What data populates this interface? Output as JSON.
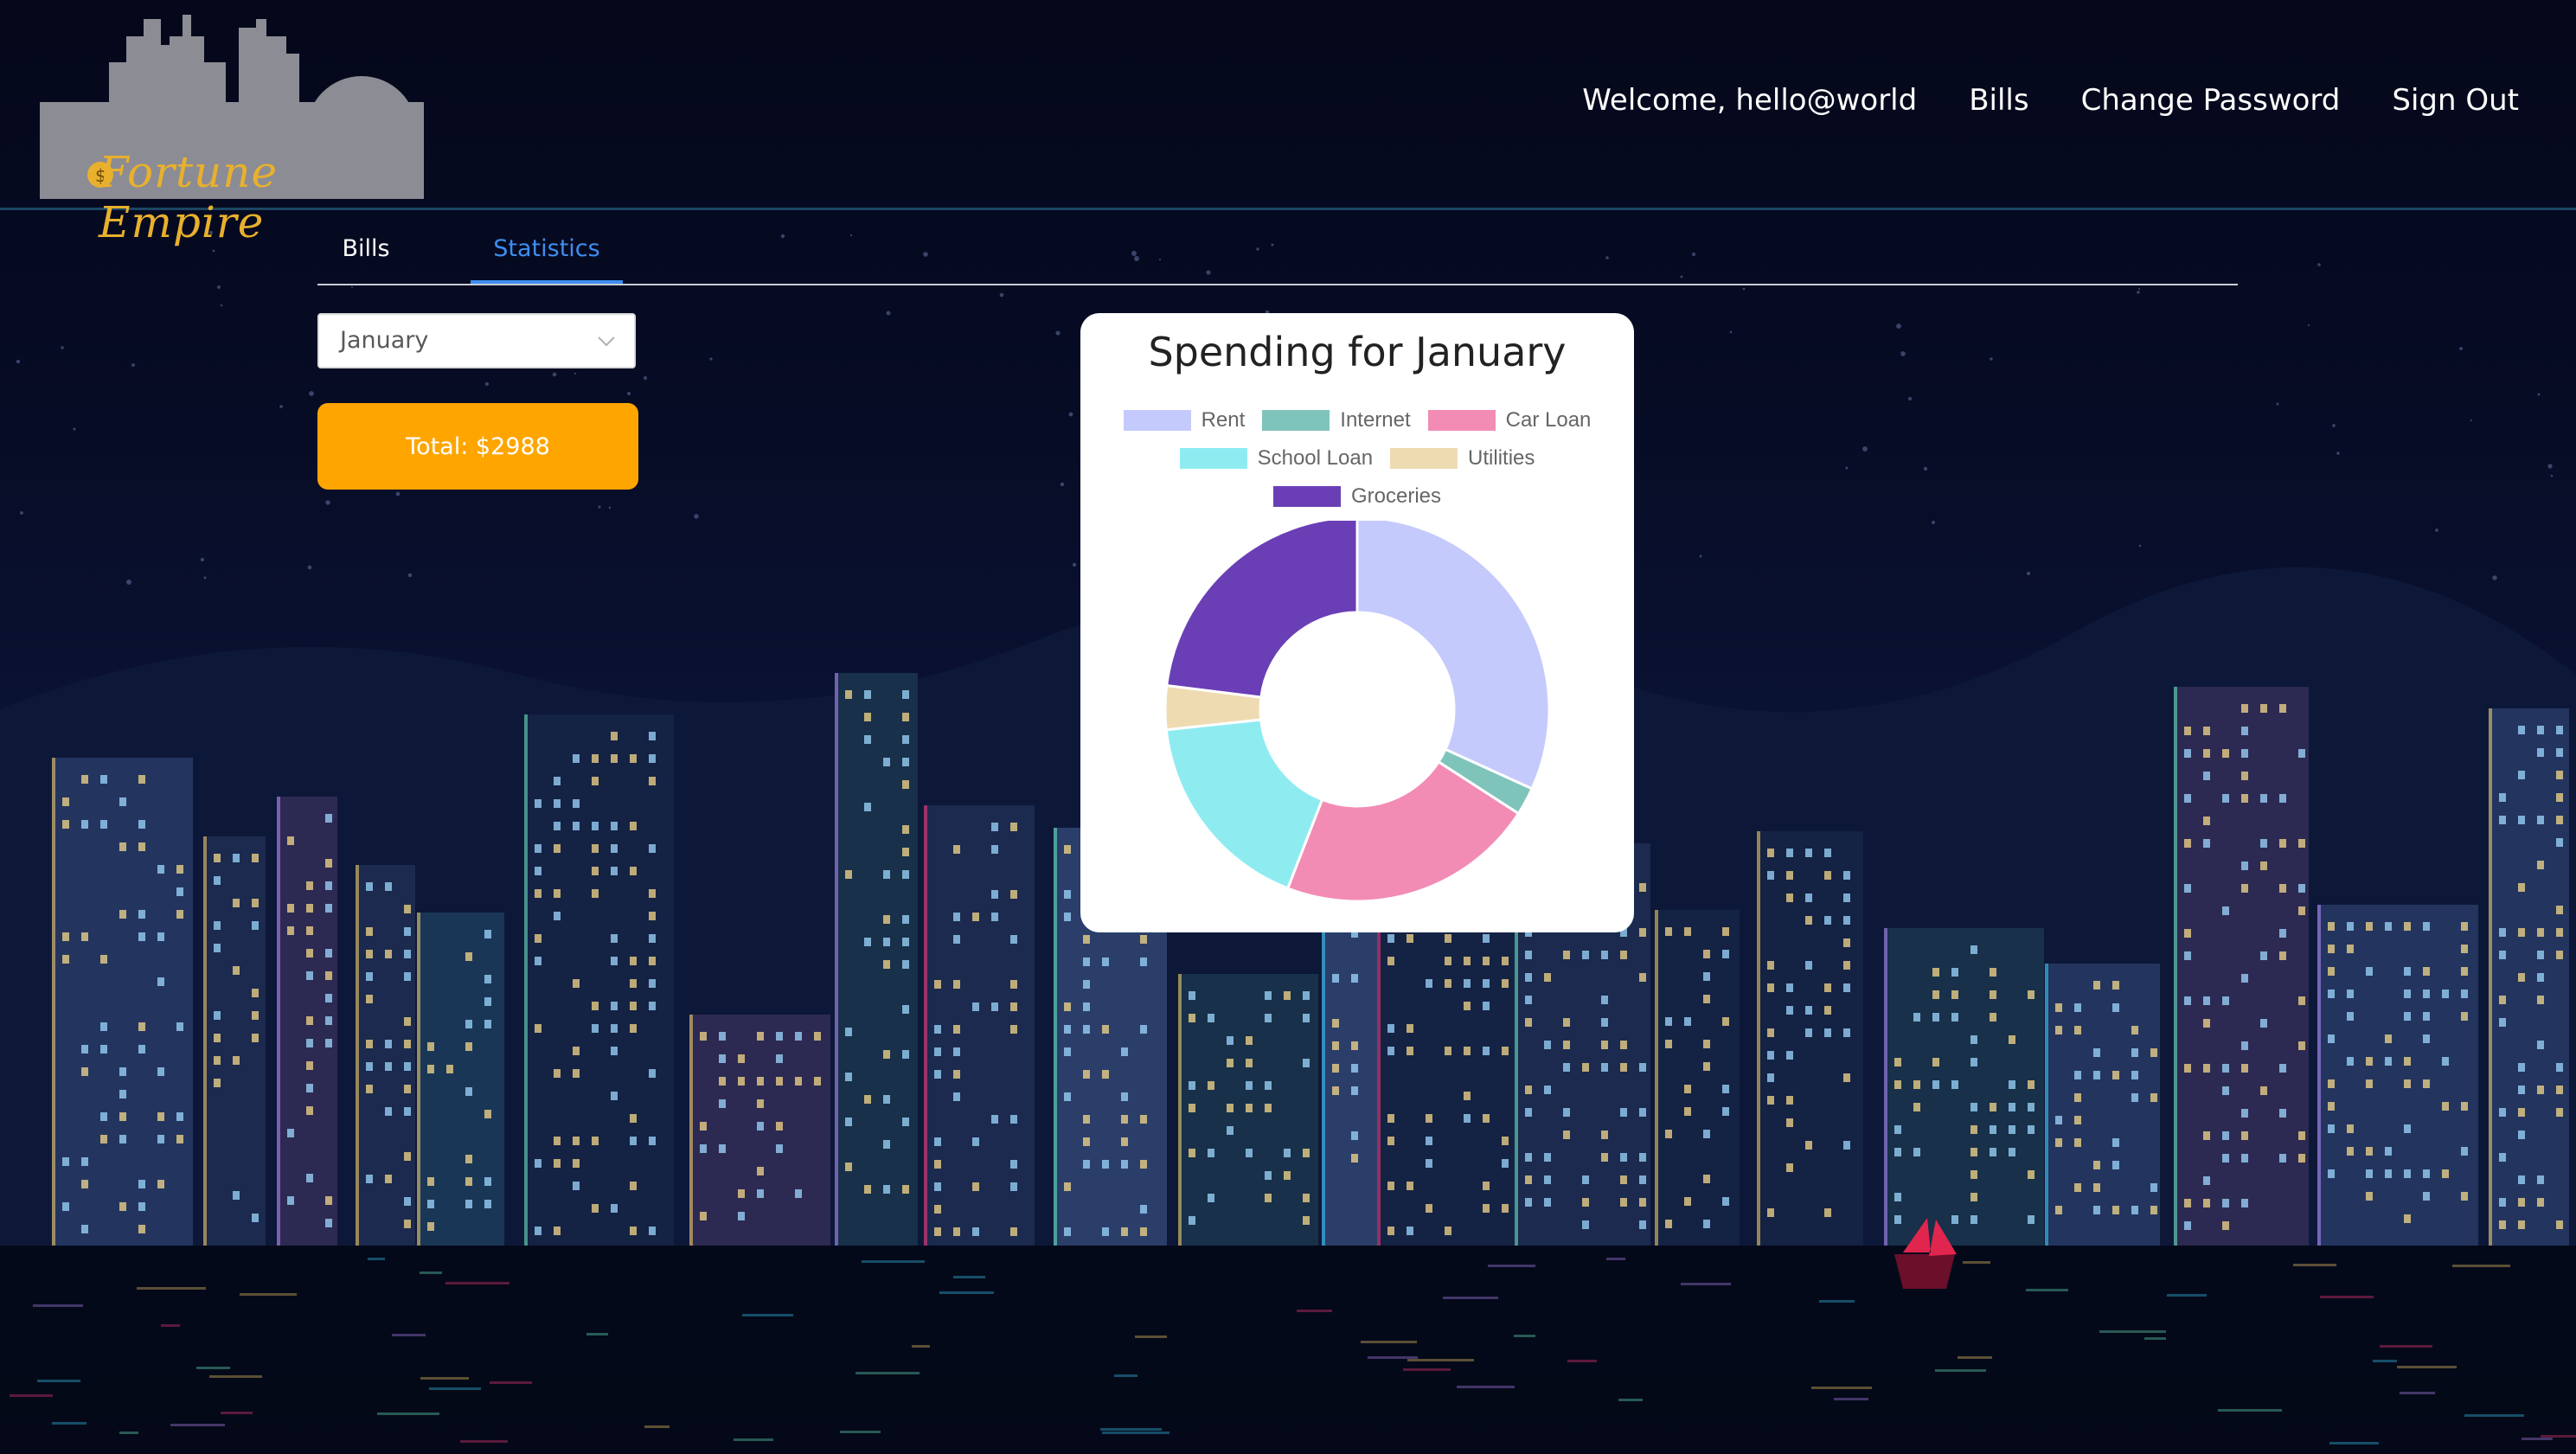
{
  "header": {
    "logo_text": "Fortune Empire",
    "nav": [
      {
        "label": "Welcome, hello@world"
      },
      {
        "label": "Bills"
      },
      {
        "label": "Change Password"
      },
      {
        "label": "Sign Out"
      }
    ]
  },
  "tabs": [
    {
      "label": "Bills",
      "active": false
    },
    {
      "label": "Statistics",
      "active": true
    }
  ],
  "month_select": {
    "value": "January"
  },
  "total_button": {
    "label": "Total: $2988"
  },
  "colors": {
    "accent": "#3d8ef0",
    "total_button": "#ffa500",
    "page_background": "#070c26"
  },
  "icons": {
    "select_chevron": "chevron-down-icon"
  },
  "chart_data": {
    "type": "pie",
    "title": "Spending for January",
    "legend_position": "top",
    "donut": true,
    "categories": [
      "Rent",
      "Internet",
      "Car Loan",
      "School Loan",
      "Utilities",
      "Groceries"
    ],
    "values": [
      950,
      70,
      650,
      520,
      110,
      688
    ],
    "colors": [
      "#c5cafc",
      "#7fc4ba",
      "#f28cb5",
      "#8eecf1",
      "#efdbb2",
      "#6a3fb6"
    ]
  }
}
